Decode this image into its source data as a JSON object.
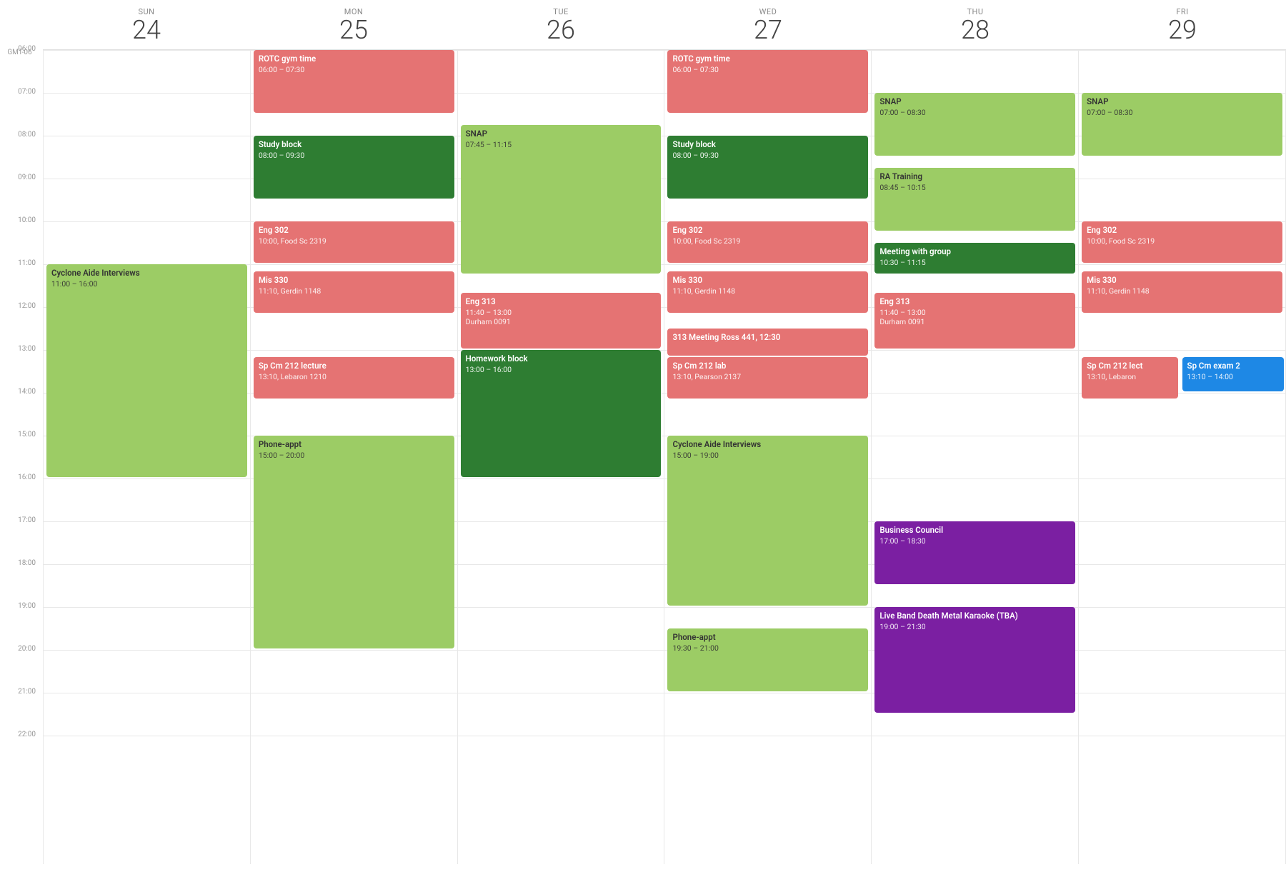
{
  "calendar": {
    "timezone": "GMT-06",
    "days": [
      {
        "name": "SUN",
        "number": "24"
      },
      {
        "name": "MON",
        "number": "25"
      },
      {
        "name": "TUE",
        "number": "26"
      },
      {
        "name": "WED",
        "number": "27"
      },
      {
        "name": "THU",
        "number": "28"
      },
      {
        "name": "FRI",
        "number": "29"
      }
    ],
    "hours": [
      "06:00",
      "07:00",
      "08:00",
      "09:00",
      "10:00",
      "11:00",
      "12:00",
      "13:00",
      "14:00",
      "15:00",
      "16:00",
      "17:00",
      "18:00",
      "19:00",
      "20:00",
      "21:00",
      "22:00"
    ],
    "events": {
      "sun": [
        {
          "title": "Cyclone Aide Interviews",
          "time": "11:00 – 16:00",
          "color": "yellow-green",
          "startHour": 11,
          "startMin": 0,
          "endHour": 16,
          "endMin": 0
        }
      ],
      "mon": [
        {
          "title": "ROTC gym time",
          "time": "06:00 – 07:30",
          "color": "salmon",
          "startHour": 6,
          "startMin": 0,
          "endHour": 7,
          "endMin": 30
        },
        {
          "title": "Study block",
          "time": "08:00 – 09:30",
          "color": "green",
          "startHour": 8,
          "startMin": 0,
          "endHour": 9,
          "endMin": 30
        },
        {
          "title": "Eng 302",
          "time": "10:00, Food Sc 2319",
          "color": "salmon",
          "startHour": 10,
          "startMin": 0,
          "endHour": 11,
          "endMin": 0
        },
        {
          "title": "Mis 330",
          "time": "11:10, Gerdin 1148",
          "color": "salmon",
          "startHour": 11,
          "startMin": 10,
          "endHour": 12,
          "endMin": 10
        },
        {
          "title": "Sp Cm 212 lecture",
          "time": "13:10, Lebaron 1210",
          "color": "salmon",
          "startHour": 13,
          "startMin": 10,
          "endHour": 14,
          "endMin": 10
        },
        {
          "title": "Phone-appt",
          "time": "15:00 – 20:00",
          "color": "yellow-green",
          "startHour": 15,
          "startMin": 0,
          "endHour": 20,
          "endMin": 0
        }
      ],
      "tue": [
        {
          "title": "SNAP",
          "time": "07:45 – 11:15",
          "color": "yellow-green",
          "startHour": 7,
          "startMin": 45,
          "endHour": 11,
          "endMin": 15
        },
        {
          "title": "Eng 313",
          "time": "11:40 – 13:00\nDurham 0091",
          "color": "salmon",
          "startHour": 11,
          "startMin": 40,
          "endHour": 13,
          "endMin": 0
        },
        {
          "title": "Homework block",
          "time": "13:00 – 16:00",
          "color": "green",
          "startHour": 13,
          "startMin": 0,
          "endHour": 16,
          "endMin": 0
        }
      ],
      "wed": [
        {
          "title": "ROTC gym time",
          "time": "06:00 – 07:30",
          "color": "salmon",
          "startHour": 6,
          "startMin": 0,
          "endHour": 7,
          "endMin": 30
        },
        {
          "title": "Study block",
          "time": "08:00 – 09:30",
          "color": "green",
          "startHour": 8,
          "startMin": 0,
          "endHour": 9,
          "endMin": 30
        },
        {
          "title": "Eng 302",
          "time": "10:00, Food Sc 2319",
          "color": "salmon",
          "startHour": 10,
          "startMin": 0,
          "endHour": 11,
          "endMin": 0
        },
        {
          "title": "Mis 330",
          "time": "11:10, Gerdin 1148",
          "color": "salmon",
          "startHour": 11,
          "startMin": 10,
          "endHour": 12,
          "endMin": 10
        },
        {
          "title": "313 Meeting Ross 441, 12:30",
          "time": "",
          "color": "salmon",
          "startHour": 12,
          "startMin": 30,
          "endHour": 13,
          "endMin": 10
        },
        {
          "title": "Sp Cm 212 lab",
          "time": "13:10, Pearson 2137",
          "color": "salmon",
          "startHour": 13,
          "startMin": 10,
          "endHour": 14,
          "endMin": 10
        },
        {
          "title": "Cyclone Aide Interviews",
          "time": "15:00 – 19:00",
          "color": "yellow-green",
          "startHour": 15,
          "startMin": 0,
          "endHour": 19,
          "endMin": 0
        },
        {
          "title": "Phone-appt",
          "time": "19:30 – 21:00",
          "color": "yellow-green",
          "startHour": 19,
          "startMin": 30,
          "endHour": 21,
          "endMin": 0
        }
      ],
      "thu": [
        {
          "title": "SNAP",
          "time": "07:00 – 08:30",
          "color": "yellow-green",
          "startHour": 7,
          "startMin": 0,
          "endHour": 8,
          "endMin": 30
        },
        {
          "title": "RA Training",
          "time": "08:45 – 10:15",
          "color": "yellow-green",
          "startHour": 8,
          "startMin": 45,
          "endHour": 10,
          "endMin": 15
        },
        {
          "title": "Meeting with group",
          "time": "10:30 – 11:15",
          "color": "green",
          "startHour": 10,
          "startMin": 30,
          "endHour": 11,
          "endMin": 15
        },
        {
          "title": "Eng 313",
          "time": "11:40 – 13:00\nDurham 0091",
          "color": "salmon",
          "startHour": 11,
          "startMin": 40,
          "endHour": 13,
          "endMin": 0
        },
        {
          "title": "Business Council",
          "time": "17:00 – 18:30",
          "color": "purple",
          "startHour": 17,
          "startMin": 0,
          "endHour": 18,
          "endMin": 30
        },
        {
          "title": "Live Band Death Metal Karaoke (TBA)",
          "time": "19:00 – 21:30",
          "color": "purple",
          "startHour": 19,
          "startMin": 0,
          "endHour": 21,
          "endMin": 30
        }
      ],
      "fri": [
        {
          "title": "SNAP",
          "time": "07:00 – 08:30",
          "color": "yellow-green",
          "startHour": 7,
          "startMin": 0,
          "endHour": 8,
          "endMin": 30
        },
        {
          "title": "Eng 302",
          "time": "10:00, Food Sc 2319",
          "color": "salmon",
          "startHour": 10,
          "startMin": 0,
          "endHour": 11,
          "endMin": 0
        },
        {
          "title": "Mis 330",
          "time": "11:10, Gerdin 1148",
          "color": "salmon",
          "startHour": 11,
          "startMin": 10,
          "endHour": 12,
          "endMin": 10
        },
        {
          "title": "Sp Cm 212 lect",
          "time": "13:10, Lebaron",
          "color": "salmon",
          "startHour": 13,
          "startMin": 10,
          "endHour": 14,
          "endMin": 10,
          "rightCut": true
        },
        {
          "title": "Sp Cm exam 2",
          "time": "13:10 – 14:00",
          "color": "blue",
          "startHour": 13,
          "startMin": 10,
          "endHour": 14,
          "endMin": 0,
          "leftSlot": true
        }
      ]
    }
  }
}
